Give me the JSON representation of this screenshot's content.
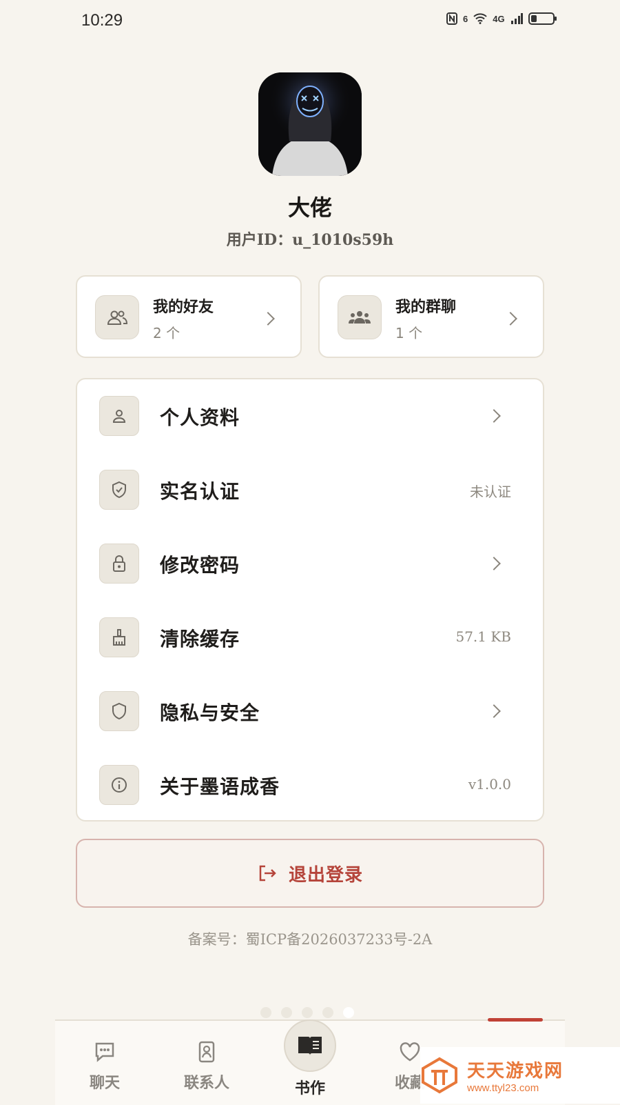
{
  "status_bar": {
    "time": "10:29",
    "signal_badges": [
      "6",
      "4G"
    ],
    "battery_level": 0.25
  },
  "profile": {
    "display_name": "大佬",
    "user_id_line": "用户ID：u_1010s59h"
  },
  "stats": [
    {
      "title": "我的好友",
      "count": "2 个",
      "icon": "friends-icon"
    },
    {
      "title": "我的群聊",
      "count": "1 个",
      "icon": "group-icon"
    }
  ],
  "menu": [
    {
      "label": "个人资料",
      "value": "",
      "chevron": true,
      "icon": "user-icon"
    },
    {
      "label": "实名认证",
      "value": "未认证",
      "chevron": false,
      "icon": "shield-check-icon"
    },
    {
      "label": "修改密码",
      "value": "",
      "chevron": true,
      "icon": "lock-icon"
    },
    {
      "label": "清除缓存",
      "value": "57.1 KB",
      "chevron": false,
      "icon": "broom-icon"
    },
    {
      "label": "隐私与安全",
      "value": "",
      "chevron": true,
      "icon": "shield-icon"
    },
    {
      "label": "关于墨语成香",
      "value": "v1.0.0",
      "chevron": false,
      "icon": "info-icon"
    }
  ],
  "logout": {
    "label": "退出登录",
    "icon": "logout-icon",
    "color": "#b5443a"
  },
  "icp": "备案号：蜀ICP备2026037233号-2A",
  "pager": {
    "count": 5,
    "active_index": 4
  },
  "tabs": [
    {
      "label": "聊天",
      "icon": "chat-icon"
    },
    {
      "label": "联系人",
      "icon": "contacts-icon"
    },
    {
      "label": "书作",
      "icon": "book-icon"
    },
    {
      "label": "收藏",
      "icon": "heart-icon"
    }
  ],
  "watermark": {
    "title": "天天游戏网",
    "url": "www.ttyl23.com"
  },
  "colors": {
    "background": "#f7f4ee",
    "accent": "#c04136",
    "card": "#ffffff"
  }
}
